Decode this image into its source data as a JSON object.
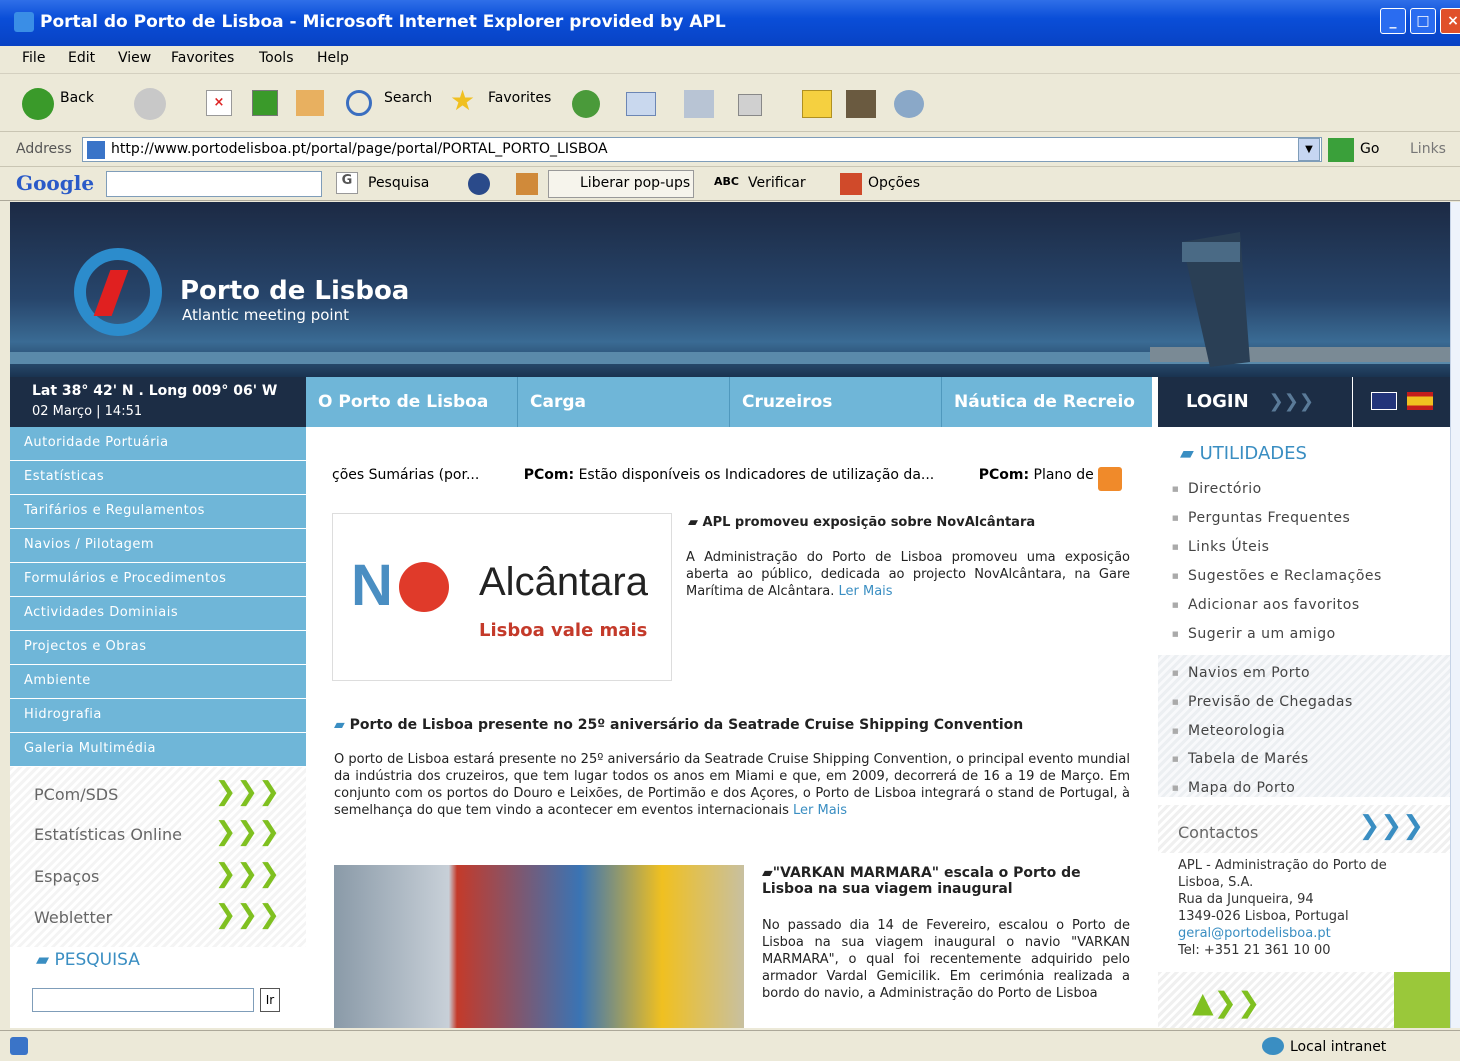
{
  "window": {
    "title": "Portal do Porto de Lisboa - Microsoft Internet Explorer provided by APL"
  },
  "menu": [
    "File",
    "Edit",
    "View",
    "Favorites",
    "Tools",
    "Help"
  ],
  "toolbar": {
    "back": "Back",
    "search": "Search",
    "favorites": "Favorites"
  },
  "address": {
    "label": "Address",
    "url": "http://www.portodelisboa.pt/portal/page/portal/PORTAL_PORTO_LISBOA",
    "go": "Go",
    "links": "Links"
  },
  "google": {
    "logo": "Google",
    "search": "Pesquisa",
    "popups": "Liberar pop-ups",
    "verify": "Verificar",
    "options": "Opções"
  },
  "site": {
    "name": "Porto de Lisboa",
    "tagline": "Atlantic meeting point",
    "geo_line1": "Lat 38° 42' N . Long 009° 06' W",
    "geo_line2": "02 Março | 14:51",
    "login": "LOGIN"
  },
  "nav": [
    "O Porto de Lisboa",
    "Carga",
    "Cruzeiros",
    "Náutica de Recreio"
  ],
  "left_menu": [
    "Autoridade Portuária",
    "Estatísticas",
    "Tarifários e Regulamentos",
    "Navios / Pilotagem",
    "Formulários e Procedimentos",
    "Actividades Dominiais",
    "Projectos e Obras",
    "Ambiente",
    "Hidrografia",
    "Galeria Multimédia"
  ],
  "left_boxes": [
    "PCom/SDS",
    "Estatísticas Online",
    "Espaços",
    "Webletter"
  ],
  "search": {
    "title": "PESQUISA",
    "button": "Ir"
  },
  "ticker": {
    "item1": "ções Sumárias (por...",
    "item2_bold": "PCom:",
    "item2": "Estão disponíveis os Indicadores de utilização da...",
    "item3_bold": "PCom:",
    "item3": "Plano de ("
  },
  "news": [
    {
      "title": "APL promoveu exposição sobre NovAlcântara",
      "body": "A Administração do Porto de Lisboa promoveu uma exposição aberta ao público, dedicada ao projecto NovAlcântara, na Gare Marítima de Alcântara.",
      "more": "Ler Mais",
      "logo_text": "Alcântara",
      "logo_sub": "Lisboa vale mais"
    },
    {
      "title": "Porto de Lisboa presente no 25º aniversário da Seatrade Cruise Shipping Convention",
      "body": "O porto de Lisboa estará presente no 25º aniversário da Seatrade Cruise Shipping Convention, o principal evento mundial da indústria dos cruzeiros, que tem lugar todos os anos em Miami e que, em 2009, decorrerá de 16 a 19 de Março. Em conjunto com os portos do Douro e Leixões, de Portimão e dos Açores, o Porto de Lisboa integrará o stand de Portugal, à semelhança do que tem vindo a acontecer em eventos internacionais",
      "more": "Ler Mais"
    },
    {
      "title": "\"VARKAN MARMARA\" escala o Porto de Lisboa na sua viagem inaugural",
      "body": "No passado dia 14 de Fevereiro, escalou o Porto de Lisboa na sua viagem inaugural o navio \"VARKAN MARMARA\", o qual foi recentemente adquirido pelo armador Vardal Gemicilik. Em cerimónia realizada a bordo do navio, a Administração do Porto de Lisboa"
    }
  ],
  "utilidades": {
    "title": "UTILIDADES",
    "items": [
      "Directório",
      "Perguntas Frequentes",
      "Links Úteis",
      "Sugestões e Reclamações",
      "Adicionar aos favoritos",
      "Sugerir a um amigo"
    ],
    "items2": [
      "Navios em Porto",
      "Previsão de Chegadas",
      "Meteorologia",
      "Tabela de Marés",
      "Mapa do Porto"
    ]
  },
  "contactos": {
    "title": "Contactos",
    "l1": "APL - Administração do Porto de",
    "l2": "Lisboa, S.A.",
    "l3": "Rua da Junqueira, 94",
    "l4": "1349-026 Lisboa, Portugal",
    "email": "geral@portodelisboa.pt",
    "tel": "Tel: +351 21 361 10 00"
  },
  "status": {
    "zone": "Local intranet"
  }
}
